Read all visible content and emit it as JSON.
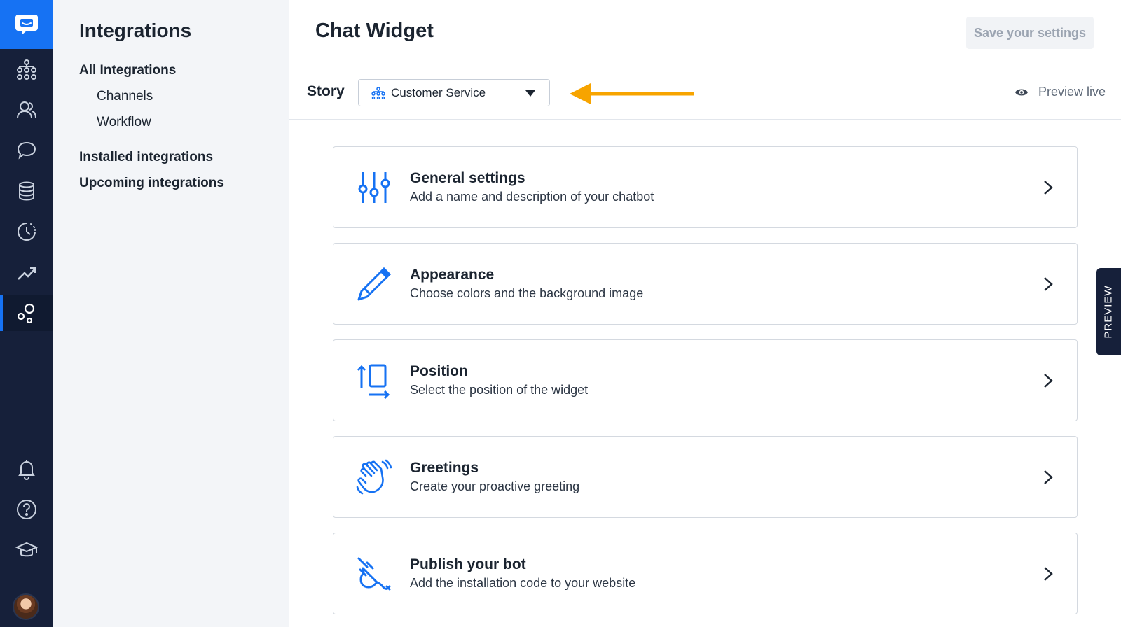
{
  "rail": {
    "items": [
      {
        "name": "flow-icon"
      },
      {
        "name": "users-icon"
      },
      {
        "name": "chat-bubbles-icon"
      },
      {
        "name": "database-icon"
      },
      {
        "name": "clock-history-icon"
      },
      {
        "name": "trend-icon"
      },
      {
        "name": "integrations-icon",
        "active": true
      },
      {
        "name": "bell-icon"
      },
      {
        "name": "help-icon"
      },
      {
        "name": "academy-icon"
      }
    ],
    "accent": "#1672f3",
    "background": "#16203a"
  },
  "subnav": {
    "title": "Integrations",
    "all_integrations": "All Integrations",
    "channels": "Channels",
    "workflow": "Workflow",
    "installed": "Installed integrations",
    "upcoming": "Upcoming integrations"
  },
  "header": {
    "title": "Chat Widget",
    "save_label": "Save your settings"
  },
  "storybar": {
    "label": "Story",
    "selected_story": "Customer Service",
    "preview_live": "Preview live",
    "arrow_color": "#f7a400"
  },
  "cards": [
    {
      "title": "General settings",
      "desc": "Add a name and description of your chatbot",
      "icon": "sliders-icon"
    },
    {
      "title": "Appearance",
      "desc": "Choose colors and the background image",
      "icon": "pencil-icon"
    },
    {
      "title": "Position",
      "desc": "Select the position of the widget",
      "icon": "position-icon"
    },
    {
      "title": "Greetings",
      "desc": "Create your proactive greeting",
      "icon": "waving-hand-icon"
    },
    {
      "title": "Publish your bot",
      "desc": "Add the installation code to your website",
      "icon": "plug-icon"
    }
  ],
  "preview_tab": "PREVIEW"
}
